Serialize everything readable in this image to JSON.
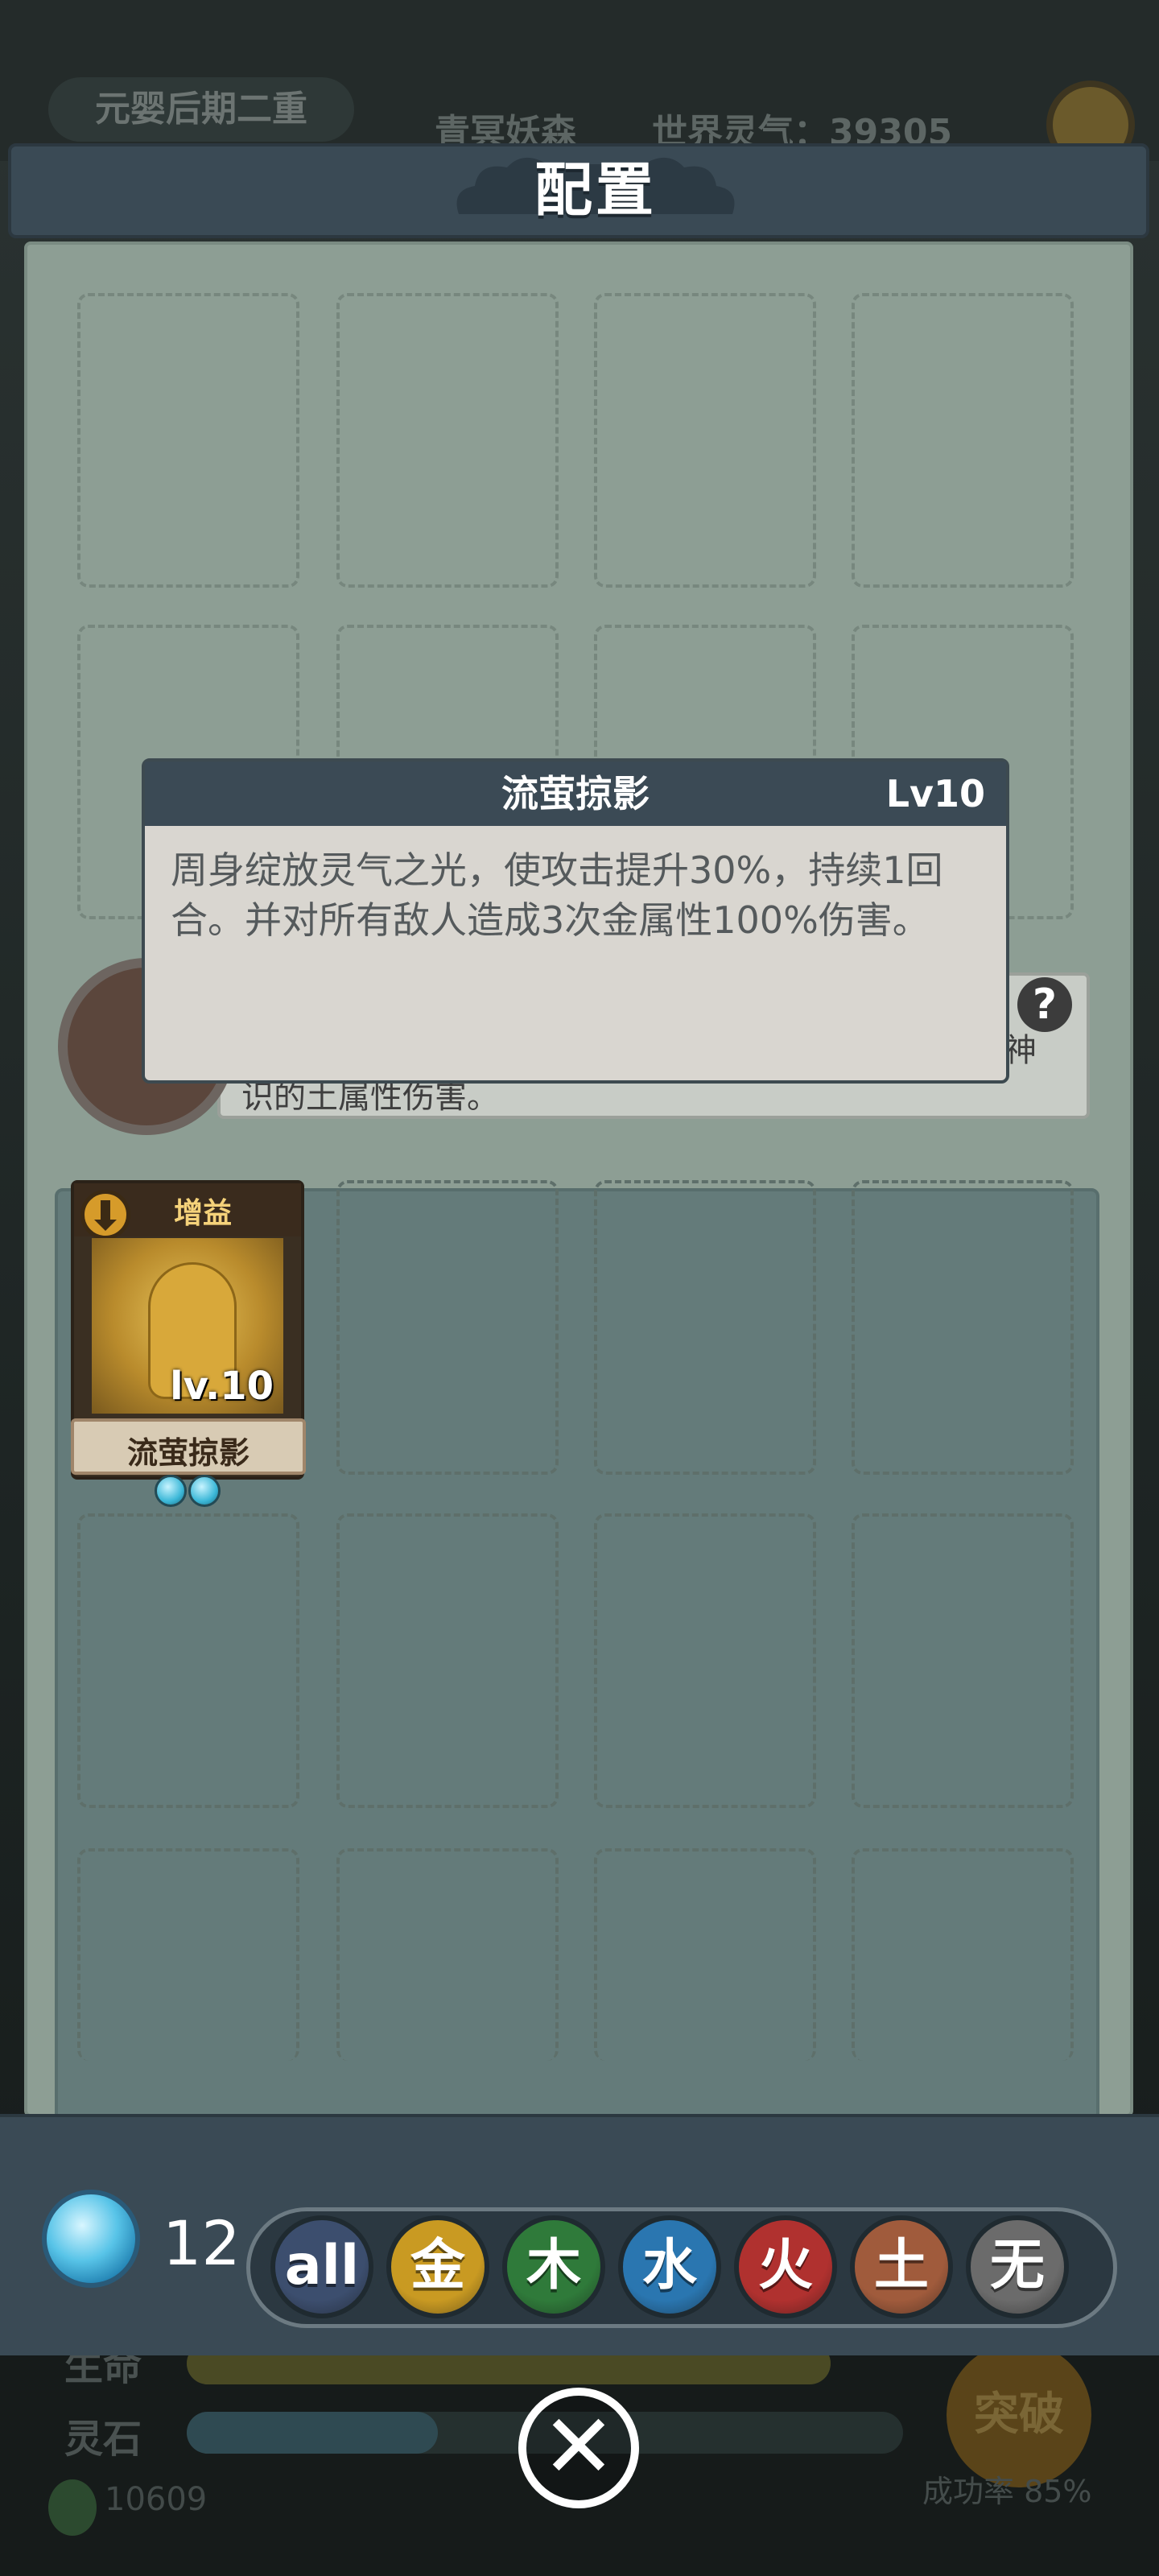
{
  "background": {
    "realm": "元婴后期二重",
    "map_name": "青冥妖森",
    "world_qi": "世界灵气：39305",
    "rows": [
      {
        "label": "生命"
      },
      {
        "label": "灵石"
      }
    ],
    "stone_count": "10609",
    "breakthrough_label": "突破",
    "success_rate": "成功率 85%"
  },
  "panel": {
    "title": "配置"
  },
  "popup": {
    "skill_name": "流萤掠影",
    "level": "Lv10",
    "description": "周身绽放灵气之光，使攻击提升30%，持续1回合。并对所有敌人造成3次金属性100%伤害。"
  },
  "underlying": {
    "text_line_end": "神",
    "text_line2": "识的土属性伤害。",
    "help_label": "?"
  },
  "card": {
    "type": "增益",
    "level": "lv.10",
    "name": "流萤掠影",
    "gems": 2
  },
  "bottom": {
    "orb_count": "12",
    "filters": [
      {
        "label": "all",
        "color": "#3c4e6e"
      },
      {
        "label": "金",
        "color": "#c99a22"
      },
      {
        "label": "木",
        "color": "#2f7a3a"
      },
      {
        "label": "水",
        "color": "#2a76b0"
      },
      {
        "label": "火",
        "color": "#b0312f"
      },
      {
        "label": "土",
        "color": "#a05b3c"
      },
      {
        "label": "无",
        "color": "#6b6b6b"
      }
    ],
    "close_label": "✕"
  }
}
